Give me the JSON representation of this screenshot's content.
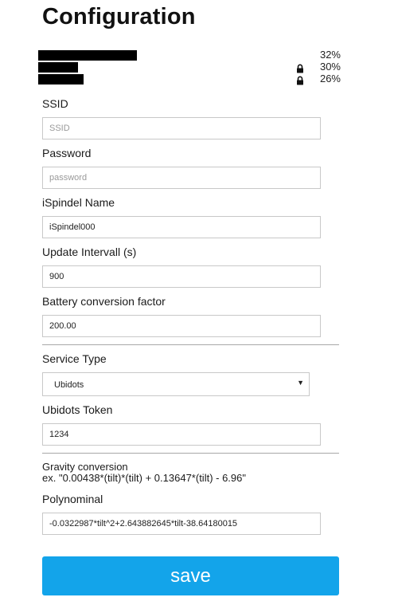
{
  "page": {
    "title": "Configuration"
  },
  "networks": [
    {
      "name": "",
      "signal": "32%",
      "secured": false
    },
    {
      "name": "",
      "signal": "30%",
      "secured": true,
      "lock_icon": "lock-icon"
    },
    {
      "name": "",
      "signal": "26%",
      "secured": true,
      "lock_icon": "lock-icon"
    }
  ],
  "form": {
    "ssid": {
      "label": "SSID",
      "placeholder": "SSID",
      "value": ""
    },
    "password": {
      "label": "Password",
      "placeholder": "password",
      "value": ""
    },
    "name": {
      "label": "iSpindel Name",
      "value": "iSpindel000"
    },
    "interval": {
      "label": "Update Intervall (s)",
      "value": "900"
    },
    "battery": {
      "label": "Battery conversion factor",
      "value": "200.00"
    },
    "service": {
      "label": "Service Type",
      "selected": "Ubidots"
    },
    "token": {
      "label": "Ubidots Token",
      "value": "1234"
    },
    "gravity": {
      "title": "Gravity conversion",
      "example": "ex. \"0.00438*(tilt)*(tilt) + 0.13647*(tilt) - 6.96\""
    },
    "polynomial": {
      "label": "Polynominal",
      "value": "-0.0322987*tilt^2+2.643882645*tilt-38.64180015"
    }
  },
  "save_label": "save",
  "colors": {
    "accent": "#13a4ea",
    "redaction": "#000000"
  }
}
